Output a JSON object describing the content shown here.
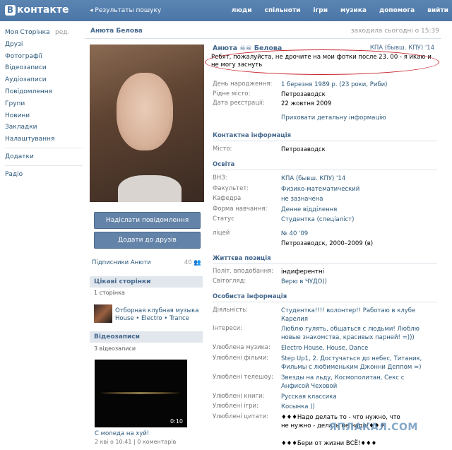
{
  "topbar": {
    "logo_letter": "B",
    "logo_text": "контакте",
    "back_label": "Результаты пошуку",
    "nav": [
      "люди",
      "спільноти",
      "ігри",
      "музика",
      "допомога",
      "вийти"
    ]
  },
  "leftnav": {
    "items": [
      "Моя Сторінка",
      "Друзі",
      "Фотографії",
      "Відеозаписи",
      "Аудіозаписи",
      "Повідомлення",
      "Групи",
      "Новини",
      "Закладки",
      "Налаштування"
    ],
    "edit_label": "ред.",
    "items2": [
      "Додатки"
    ],
    "items3": [
      "Радіо"
    ]
  },
  "header": {
    "name": "Анюта Белова",
    "online": "заходила сьогодні о 15:39"
  },
  "buttons": {
    "send_message": "Надіслати повідомлення",
    "add_friend": "Додати до друзів"
  },
  "subscribers": {
    "label": "Підписники Анюти",
    "count": "40"
  },
  "interesting": {
    "title": "Цікаві сторінки",
    "count_label": "1 сторінка",
    "club_name": "Отборная клубная музыка",
    "club_tags": "House • Electro • Trance"
  },
  "videos": {
    "title": "Відеозаписи",
    "count_label": "3 відеозаписи",
    "duration": "0:10",
    "video_title": "С мопеда на хуй!",
    "video_meta": "2 кві о 10:41 | 0 коментарів"
  },
  "profile": {
    "name": "Анюта ☠☠ Белова",
    "university_short": "КПА (бывш. КПУ) '14",
    "status": "Ребят, пожалуйста, не дрочите на мои фотки после 23. 00 - я икаю и не могу заснуть",
    "basic": [
      {
        "label": "День народження:",
        "value": "1 березня 1989 р. (23 роки, Риби)",
        "link": true
      },
      {
        "label": "Рідне місто:",
        "value": "Петрозаводск",
        "link": false
      },
      {
        "label": "Дата реєстрації:",
        "value": "22 жовтня 2009",
        "link": false
      }
    ],
    "hide_details": "Приховати детальну інформацію",
    "contact_title": "Контактна інформація",
    "contact": [
      {
        "label": "Місто:",
        "value": "Петрозаводск",
        "link": true
      }
    ],
    "education_title": "Освіта",
    "education": [
      {
        "label": "ВНЗ:",
        "value": "КПА (бывш. КПУ) '14",
        "link": true
      },
      {
        "label": "Факультет:",
        "value": "Физико-математический",
        "link": true
      },
      {
        "label": "Кафедра",
        "value": "не зазначена",
        "link": true
      },
      {
        "label": "Форма навчання:",
        "value": "Денне відділення",
        "link": true
      },
      {
        "label": "Статус",
        "value": "Студентка (спеціаліст)",
        "link": true
      }
    ],
    "school_label": "ліцей",
    "school_value1": "№ 40 '09",
    "school_value2": "Петрозаводск, 2000–2009 (в)",
    "life_title": "Життєва позиція",
    "life": [
      {
        "label": "Політ. вподобання:",
        "value": "індиферентні",
        "link": false
      },
      {
        "label": "Світогляд:",
        "value": "Верю в ЧУДО))",
        "link": true
      }
    ],
    "personal_title": "Особиста інформація",
    "personal": [
      {
        "label": "Діяльність:",
        "value": "Студентка!!!! волонтер!! Работаю в клубе Карелия",
        "link": true
      },
      {
        "label": "Інтереси:",
        "value": "Люблю гулять, общаться с людьми! Люблю новые знакомства, красивых парней! =)))",
        "link": true
      },
      {
        "label": "Улюблена музика:",
        "value": "Electro House, House, Dance",
        "link": true
      },
      {
        "label": "Улюблені фільми:",
        "value": "Step Up1, 2. Достучаться до небес, Титаник, Фильмы с любименьким Джонни Деппом =)",
        "link": true
      },
      {
        "label": "Улюблені телешоу:",
        "value": "Звезды на льду, Космополитан, Секс с Анфисой Чеховой",
        "link": true
      },
      {
        "label": "Улюблені книги:",
        "value": "Русская классика",
        "link": true
      },
      {
        "label": "Улюблені ігри:",
        "value": "Косынка ))",
        "link": true
      },
      {
        "label": "Улюблені цитати:",
        "value": "♦♦♦Надо делать то - что нужно, что не нужно - делать не надо!♦♦♦",
        "link": false
      }
    ],
    "quote2": "♦♦♦Бери от жизни ВСЁ!♦♦♦"
  },
  "watermark": "ЯПЛАКАЛ.COM"
}
